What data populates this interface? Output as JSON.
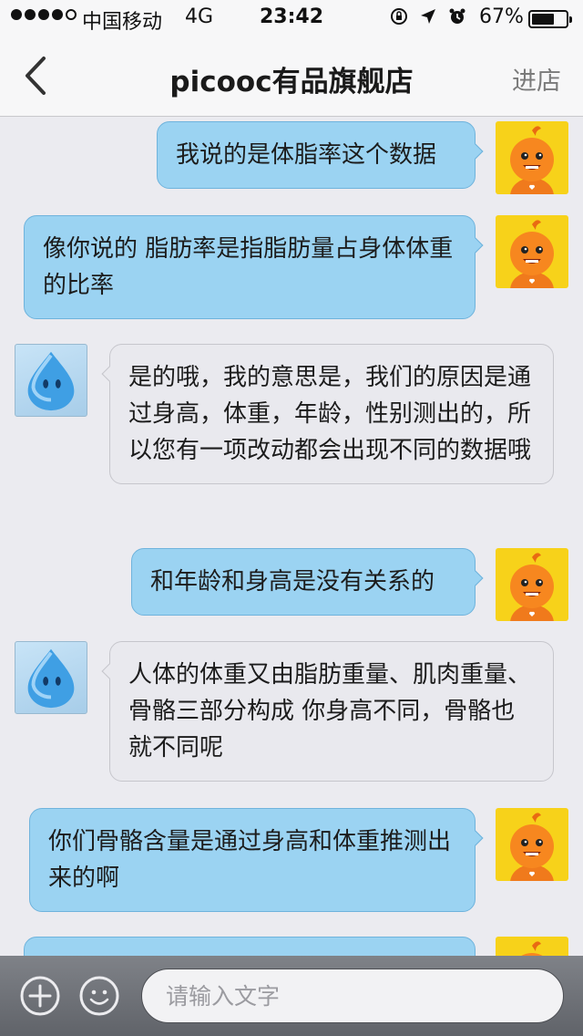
{
  "status_bar": {
    "carrier": "中国移动",
    "network": "4G",
    "time": "23:42",
    "battery": "67%",
    "battery_level": 0.67,
    "icons": [
      "orientation-lock-icon",
      "location-arrow-icon",
      "alarm-icon"
    ]
  },
  "nav": {
    "back_icon": "chevron-left-icon",
    "title": "picooc有品旗舰店",
    "enter_label": "进店"
  },
  "messages": [
    {
      "from": "me",
      "text": "我说的是体脂率这个数据"
    },
    {
      "from": "me",
      "text": "像你说的 脂肪率是指脂肪量占身体体重的比率"
    },
    {
      "from": "them",
      "text": "是的哦，我的意思是，我们的原因是通过身高，体重，年龄，性别测出的，所以您有一项改动都会出现不同的数据哦"
    },
    {
      "from": "me",
      "text": "和年龄和身高是没有关系的"
    },
    {
      "from": "them",
      "text": "人体的体重又由脂肪重量、肌肉重量、骨骼三部分构成  你身高不同，骨骼也就不同呢"
    },
    {
      "from": "me",
      "text": "你们骨骼含量是通过身高和体重推测出来的啊"
    },
    {
      "from": "me",
      "text": ""
    }
  ],
  "input_bar": {
    "placeholder": "请输入文字",
    "add_icon": "plus-circle-icon",
    "emoji_icon": "smiley-icon"
  },
  "colors": {
    "my_bubble": "#9bd3f2",
    "their_bubble": "#e9e9ee",
    "my_avatar_bg": "#f7d21a",
    "their_avatar": "#3a9be0"
  }
}
